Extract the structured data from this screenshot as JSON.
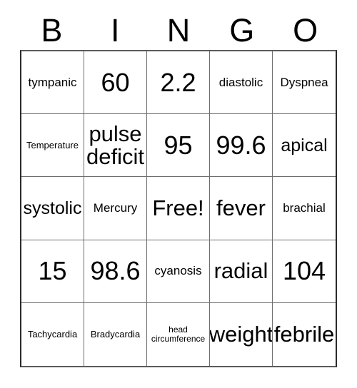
{
  "card": {
    "type": "bingo-card",
    "header_letters": [
      "B",
      "I",
      "N",
      "G",
      "O"
    ],
    "columns": 5,
    "rows": 5,
    "free_space": {
      "row": 3,
      "column": 3,
      "label": "Free!"
    },
    "colors": {
      "background": "#ffffff",
      "text": "#000000",
      "grid_line": "#6e6e6e",
      "outer_border": "#2b2b2b"
    },
    "rows_data": [
      [
        {
          "text": "tympanic",
          "size": "sz-m"
        },
        {
          "text": "60",
          "size": "sz-xxl"
        },
        {
          "text": "2.2",
          "size": "sz-xxl"
        },
        {
          "text": "diastolic",
          "size": "sz-m"
        },
        {
          "text": "Dyspnea",
          "size": "sz-m"
        }
      ],
      [
        {
          "text": "Temperature",
          "size": "sz-s"
        },
        {
          "text": "pulse deficit",
          "size": "sz-xl"
        },
        {
          "text": "95",
          "size": "sz-xxl"
        },
        {
          "text": "99.6",
          "size": "sz-xxl"
        },
        {
          "text": "apical",
          "size": "sz-l"
        }
      ],
      [
        {
          "text": "systolic",
          "size": "sz-l"
        },
        {
          "text": "Mercury",
          "size": "sz-m"
        },
        {
          "text": "Free!",
          "size": "sz-xl"
        },
        {
          "text": "fever",
          "size": "sz-xl"
        },
        {
          "text": "brachial",
          "size": "sz-m"
        }
      ],
      [
        {
          "text": "15",
          "size": "sz-xxl"
        },
        {
          "text": "98.6",
          "size": "sz-xxl"
        },
        {
          "text": "cyanosis",
          "size": "sz-m"
        },
        {
          "text": "radial",
          "size": "sz-xl"
        },
        {
          "text": "104",
          "size": "sz-xxl"
        }
      ],
      [
        {
          "text": "Tachycardia",
          "size": "sz-s"
        },
        {
          "text": "Bradycardia",
          "size": "sz-s"
        },
        {
          "text": "head circumference",
          "size": "sz-xs"
        },
        {
          "text": "weight",
          "size": "sz-xl"
        },
        {
          "text": "febrile",
          "size": "sz-xl"
        }
      ]
    ]
  }
}
